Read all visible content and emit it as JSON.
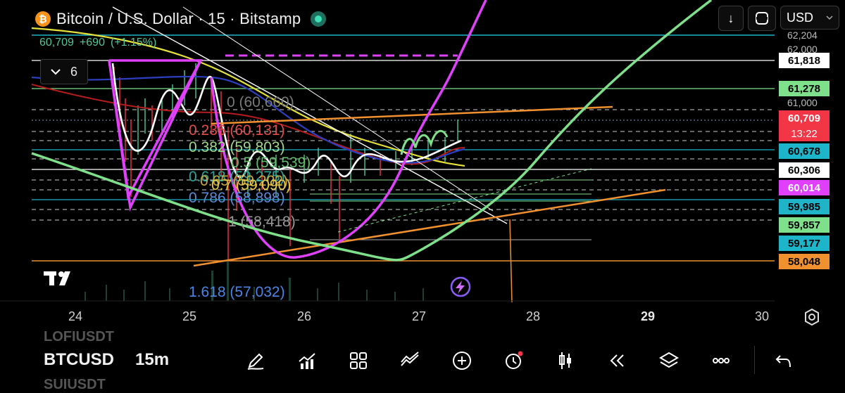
{
  "header": {
    "logo_glyph": "₿",
    "title": "Bitcoin / U.S. Dollar · 15 · Bitstamp",
    "last_price": "60,709",
    "change": "+690",
    "change_pct": "(+1.15%)"
  },
  "indicators_toggle": {
    "count": "6",
    "icon": "chevron-down-icon"
  },
  "top_toolbar": {
    "download_icon": "↓",
    "currency": "USD"
  },
  "price_axis": {
    "faded_labels": [
      "62,204",
      "62,000",
      "61,000"
    ],
    "tags": [
      {
        "value": "61,818",
        "bg": "#ffffff",
        "fg": "#000000"
      },
      {
        "value": "61,278",
        "bg": "#7ee08a",
        "fg": "#000000"
      },
      {
        "value": "60,709",
        "bg": "#f23645",
        "fg": "#ffffff"
      },
      {
        "value": "13:22",
        "bg": "#f23645",
        "fg": "#ffffff"
      },
      {
        "value": "60,678",
        "bg": "#1cb5c9",
        "fg": "#000000"
      },
      {
        "value": "60,306",
        "bg": "#ffffff",
        "fg": "#000000"
      },
      {
        "value": "60,014",
        "bg": "#e040fb",
        "fg": "#ffffff"
      },
      {
        "value": "59,985",
        "bg": "#1fb4c8",
        "fg": "#000000"
      },
      {
        "value": "59,857",
        "bg": "#7ee08a",
        "fg": "#000000"
      },
      {
        "value": "59,177",
        "bg": "#1cb5c9",
        "fg": "#000000"
      },
      {
        "value": "58,048",
        "bg": "#f0902f",
        "fg": "#000000"
      }
    ]
  },
  "time_axis": {
    "labels": [
      "24",
      "25",
      "26",
      "27",
      "28",
      "29",
      "30"
    ],
    "bold_label": "29"
  },
  "fib_labels": [
    {
      "text": "0 (60,660)",
      "color": "#7a7a7a"
    },
    {
      "text": "0.236 (60,131)",
      "color": "#e24b4b"
    },
    {
      "text": "0.382 (59,803)",
      "color": "#9fd98a"
    },
    {
      "text": "0.5 (59,539)",
      "color": "#5fbf6a"
    },
    {
      "text": "0.618 (59,275)",
      "color": "#2aa79b"
    },
    {
      "text": "0.65 (59,202)",
      "color": "#c8a93c"
    },
    {
      "text": "0.7 (59,090)",
      "color": "#e6c84a"
    },
    {
      "text": "0.786 (58,898)",
      "color": "#5f8ad9"
    },
    {
      "text": "1 (58,418)",
      "color": "#9a9a9a"
    },
    {
      "text": "1.618 (57,032)",
      "color": "#4a86e8"
    }
  ],
  "watermark": "TV",
  "bottom_bar": {
    "faded_above": "LOFIUSDT",
    "symbol": "BTCUSD",
    "timeframe": "15m",
    "faded_below": "SUIUSDT",
    "tools": [
      "pencil-icon",
      "indicators-icon",
      "grid-icon",
      "trend-line-icon",
      "plus-icon",
      "alarm-icon",
      "candles-icon",
      "replay-icon",
      "layers-icon",
      "more-icon",
      "undo-icon"
    ]
  }
}
